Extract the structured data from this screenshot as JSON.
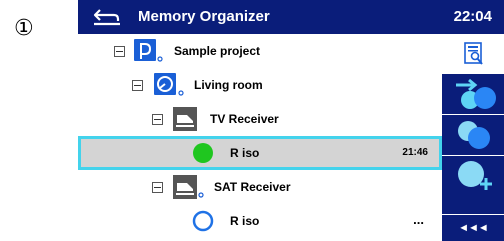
{
  "step_marker": "①",
  "header": {
    "title": "Memory Organizer",
    "clock": "22:04"
  },
  "tree": {
    "project": {
      "label": "Sample project",
      "icon": "project-icon"
    },
    "room": {
      "label": "Living room",
      "icon": "room-icon"
    },
    "device1": {
      "label": "TV Receiver",
      "icon": "device-icon"
    },
    "measurement1": {
      "label": "R iso",
      "time": "21:46",
      "status": "passed",
      "status_color": "#1fc61f"
    },
    "device2": {
      "label": "SAT Receiver",
      "icon": "device-icon"
    },
    "measurement2": {
      "label": "R iso",
      "more": "...",
      "status": "empty",
      "status_color": "#1f72e6"
    }
  },
  "sidebar": {
    "buttons": [
      "view-details-icon",
      "start-test-icon",
      "clone-icon",
      "add-new-icon"
    ],
    "collapse_label": "◄◄◄"
  },
  "colors": {
    "header_bg": "#0a1d7a",
    "sidebar_bg": "#0a1d7a",
    "selection_border": "#43d3ec",
    "selection_bg": "#d4d4d4"
  }
}
